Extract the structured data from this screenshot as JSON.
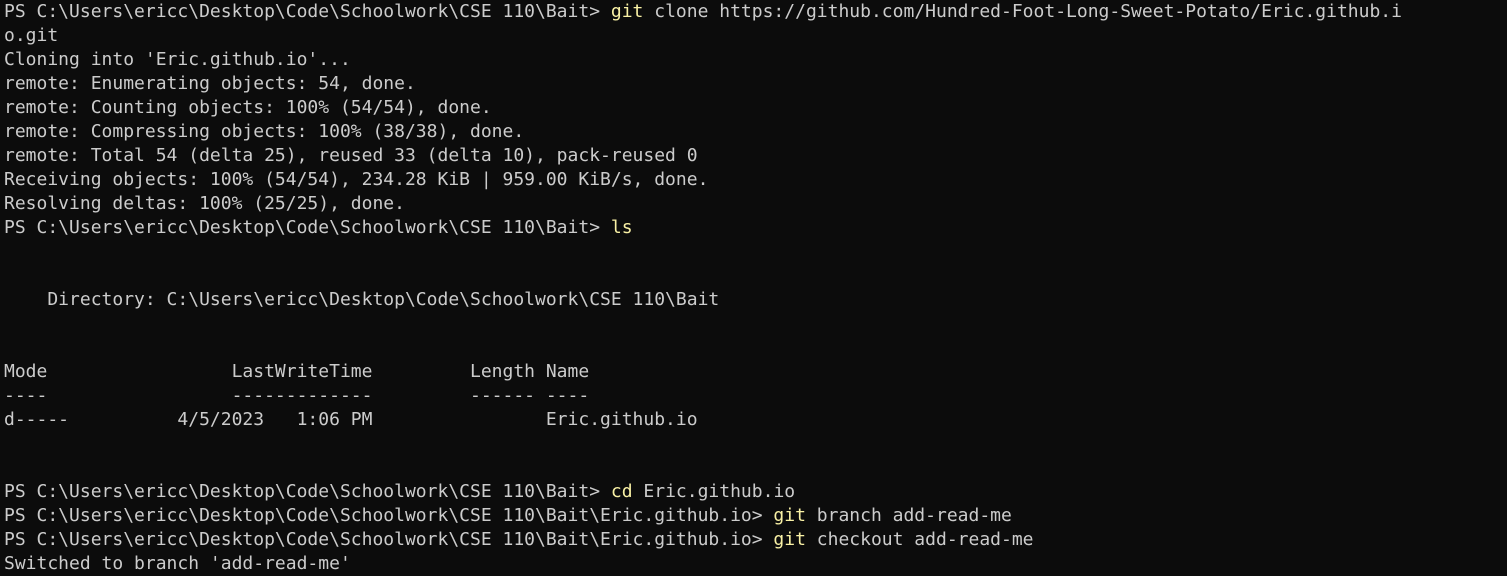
{
  "terminal": {
    "colors": {
      "background": "#0c0c0c",
      "foreground": "#cccccc",
      "command": "#f9f1a5"
    },
    "lines": [
      {
        "text": "PS C:\\Users\\ericc\\Desktop\\Code\\Schoolwork\\CSE 110\\Bait> ",
        "cmd": "git",
        "rest": " clone https://github.com/Hundred-Foot-Long-Sweet-Potato/Eric.github.i"
      },
      {
        "text": "o.git"
      },
      {
        "text": "Cloning into 'Eric.github.io'..."
      },
      {
        "text": "remote: Enumerating objects: 54, done."
      },
      {
        "text": "remote: Counting objects: 100% (54/54), done."
      },
      {
        "text": "remote: Compressing objects: 100% (38/38), done."
      },
      {
        "text": "remote: Total 54 (delta 25), reused 33 (delta 10), pack-reused 0"
      },
      {
        "text": "Receiving objects: 100% (54/54), 234.28 KiB | 959.00 KiB/s, done."
      },
      {
        "text": "Resolving deltas: 100% (25/25), done."
      },
      {
        "text": "PS C:\\Users\\ericc\\Desktop\\Code\\Schoolwork\\CSE 110\\Bait> ",
        "cmd": "ls",
        "rest": ""
      },
      {
        "text": ""
      },
      {
        "text": ""
      },
      {
        "text": "    Directory: C:\\Users\\ericc\\Desktop\\Code\\Schoolwork\\CSE 110\\Bait"
      },
      {
        "text": ""
      },
      {
        "text": ""
      },
      {
        "text": "Mode                 LastWriteTime         Length Name"
      },
      {
        "text": "----                 -------------         ------ ----"
      },
      {
        "text": "d-----          4/5/2023   1:06 PM                Eric.github.io"
      },
      {
        "text": ""
      },
      {
        "text": ""
      },
      {
        "text": "PS C:\\Users\\ericc\\Desktop\\Code\\Schoolwork\\CSE 110\\Bait> ",
        "cmd": "cd",
        "rest": " Eric.github.io"
      },
      {
        "text": "PS C:\\Users\\ericc\\Desktop\\Code\\Schoolwork\\CSE 110\\Bait\\Eric.github.io> ",
        "cmd": "git",
        "rest": " branch add-read-me"
      },
      {
        "text": "PS C:\\Users\\ericc\\Desktop\\Code\\Schoolwork\\CSE 110\\Bait\\Eric.github.io> ",
        "cmd": "git",
        "rest": " checkout add-read-me"
      },
      {
        "text": "Switched to branch 'add-read-me'"
      }
    ]
  }
}
